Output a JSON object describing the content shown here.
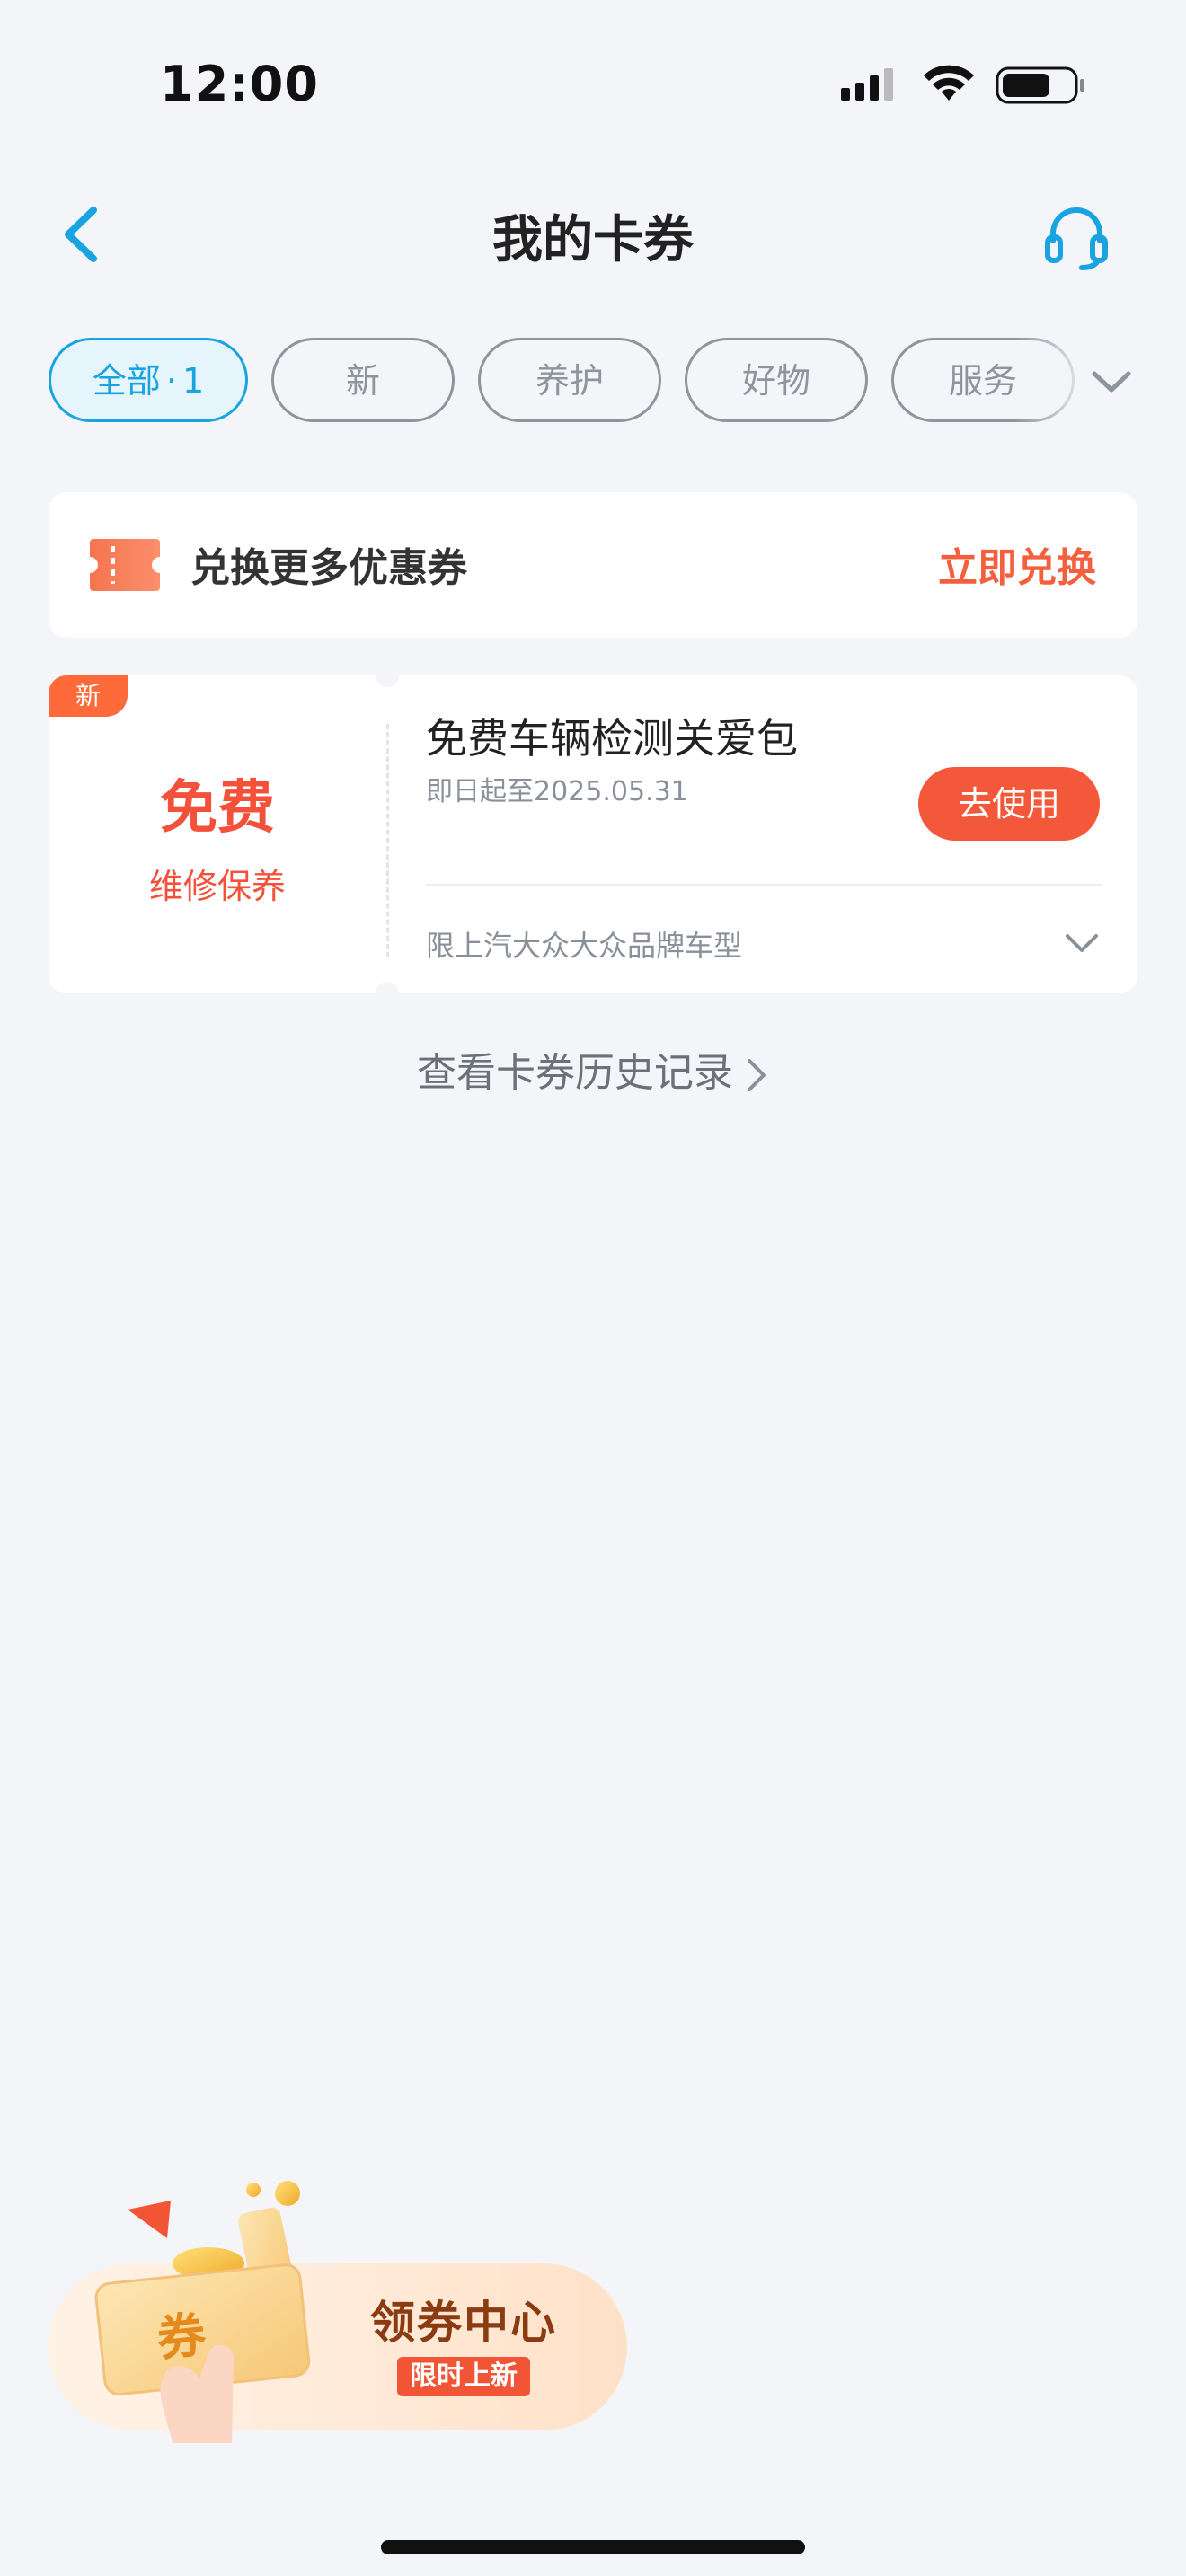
{
  "status_bar": {
    "time": "12:00"
  },
  "header": {
    "title": "我的卡券"
  },
  "tabs": [
    {
      "label": "全部",
      "count": "1"
    },
    {
      "label": "新"
    },
    {
      "label": "养护"
    },
    {
      "label": "好物"
    },
    {
      "label": "服务"
    }
  ],
  "exchange": {
    "label": "兑换更多优惠券",
    "action": "立即兑换"
  },
  "coupon": {
    "badge": "新",
    "amount": "免费",
    "category": "维修保养",
    "name": "免费车辆检测关爱包",
    "validity": "即日起至2025.05.31",
    "button": "去使用",
    "restriction": "限上汽大众大众品牌车型"
  },
  "history_link": "查看卡券历史记录",
  "coupon_center": {
    "art_label": "券",
    "title": "领券中心",
    "tag": "限时上新"
  },
  "colors": {
    "accent_blue": "#1aa3e1",
    "accent_orange": "#f4583a",
    "background": "#f4f5f8"
  }
}
